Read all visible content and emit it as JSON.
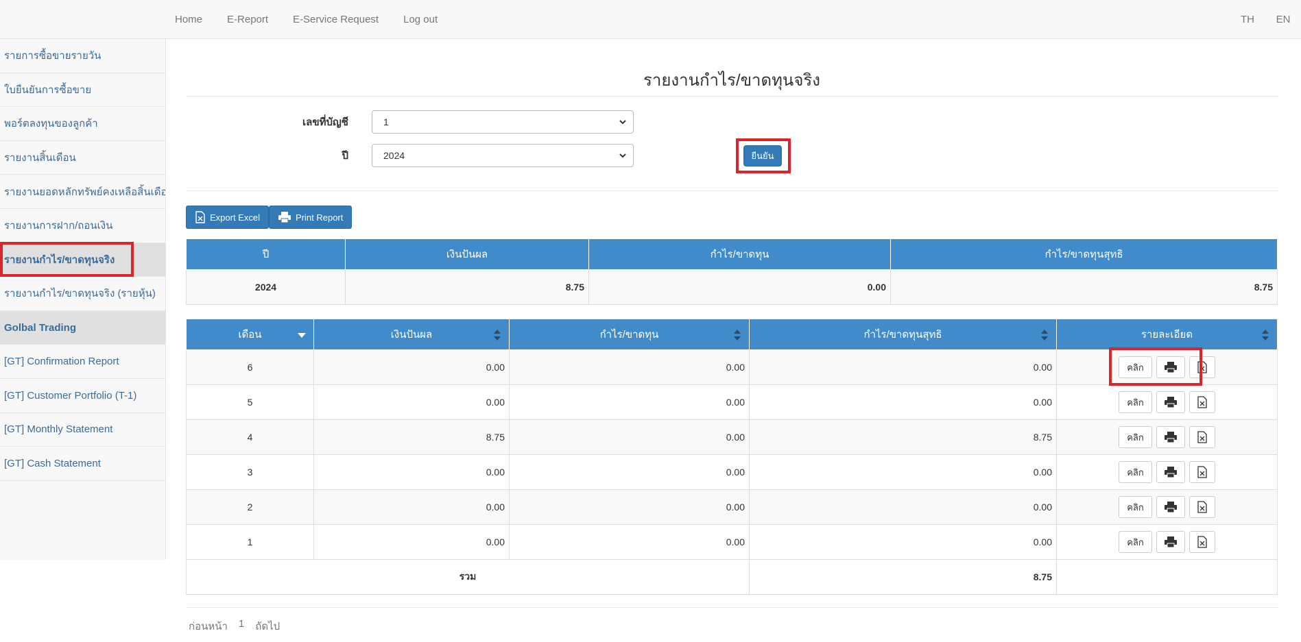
{
  "nav": {
    "items": [
      "Home",
      "E-Report",
      "E-Service Request",
      "Log out"
    ],
    "lang": [
      "TH",
      "EN"
    ]
  },
  "sidebar": {
    "items": [
      "รายการซื้อขายรายวัน",
      "ใบยืนยันการซื้อขาย",
      "พอร์ตลงทุนของลูกค้า",
      "รายงานสิ้นเดือน",
      "รายงานยอดหลักทรัพย์คงเหลือสิ้นเดือน",
      "รายงานการฝาก/ถอนเงิน",
      "รายงานกำไร/ขาดทุนจริง",
      "รายงานกำไร/ขาดทุนจริง (รายหุ้น)",
      "Golbal Trading",
      "[GT] Confirmation Report",
      "[GT] Customer Portfolio (T-1)",
      "[GT] Monthly Statement",
      "[GT] Cash Statement"
    ]
  },
  "page": {
    "title": "รายงานกำไร/ขาดทุนจริง"
  },
  "form": {
    "account_label": "เลขที่บัญชี",
    "account_value": "1",
    "year_label": "ปี",
    "year_value": "2024",
    "confirm_label": "ยืนยัน"
  },
  "toolbar": {
    "export_label": "Export Excel",
    "print_label": "Print Report"
  },
  "summary": {
    "headers": [
      "ปี",
      "เงินปันผล",
      "กำไร/ขาดทุน",
      "กำไร/ขาดทุนสุทธิ"
    ],
    "row": [
      "2024",
      "8.75",
      "0.00",
      "8.75"
    ]
  },
  "monthly": {
    "headers": [
      "เดือน",
      "เงินปันผล",
      "กำไร/ขาดทุน",
      "กำไร/ขาดทุนสุทธิ",
      "รายละเอียด"
    ],
    "rows": [
      [
        "6",
        "0.00",
        "0.00",
        "0.00"
      ],
      [
        "5",
        "0.00",
        "0.00",
        "0.00"
      ],
      [
        "4",
        "8.75",
        "0.00",
        "8.75"
      ],
      [
        "3",
        "0.00",
        "0.00",
        "0.00"
      ],
      [
        "2",
        "0.00",
        "0.00",
        "0.00"
      ],
      [
        "1",
        "0.00",
        "0.00",
        "0.00"
      ]
    ],
    "click_label": "คลิก",
    "total_label": "รวม",
    "total_value": "8.75"
  },
  "pager": {
    "prev": "ก่อนหน้า",
    "page": "1",
    "next": "ถัดไป"
  },
  "colors": {
    "primary": "#337ab7",
    "table_header": "#428bca",
    "highlight": "#d9252e"
  }
}
